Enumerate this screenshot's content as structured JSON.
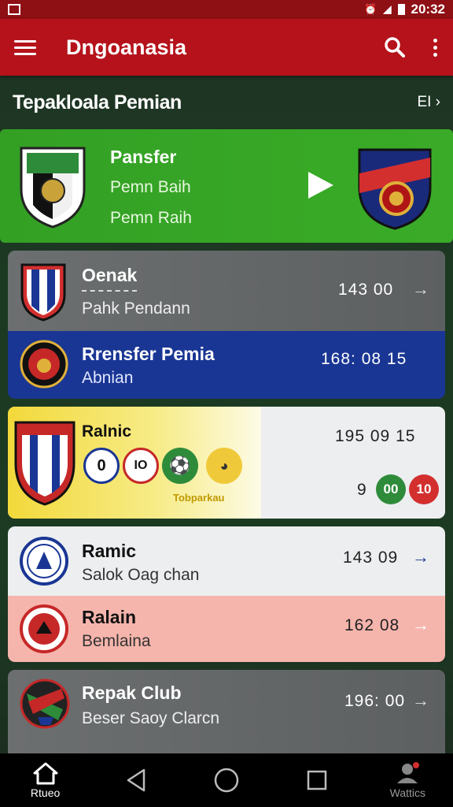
{
  "status_bar": {
    "time": "20:32"
  },
  "app_bar": {
    "title": "Dngoanasia"
  },
  "section": {
    "title": "Tepakloala Pemian",
    "link": "EI ›"
  },
  "featured": {
    "title": "Pansfer",
    "line1": "Pemn Baih",
    "line2": "Pemn Raih",
    "colors": {
      "background": "#35a325"
    }
  },
  "matches": [
    {
      "name": "Oenak",
      "subtitle": "Pahk Pendann",
      "time": "143  00",
      "arrow": "→"
    },
    {
      "name": "Rrensfer Pemia",
      "subtitle": "Abnian",
      "time": "168:  08   15"
    },
    {
      "name": "Ralnic",
      "time": "195  09   15",
      "score_left": "9",
      "score_mid": "00",
      "score_right": "10",
      "promo": "Tobparkau",
      "badges": [
        "0",
        "IO",
        "",
        ""
      ]
    },
    {
      "name": "Ramic",
      "subtitle": "Salok Oag chan",
      "time": "143  09",
      "arrow": "→"
    },
    {
      "name": "Ralain",
      "subtitle": "Bemlaina",
      "time": "162  08",
      "arrow": "→"
    },
    {
      "name": "Repak Club",
      "subtitle": "Beser Saoy Clarcn",
      "time": "196:  00",
      "arrow": "→"
    }
  ],
  "nav": {
    "home_label": "Rtueo",
    "profile_label": "Wattics"
  },
  "colors": {
    "app_bar": "#b5121b",
    "accent_green": "#33a024",
    "accent_red": "#d32f2f",
    "blue_row": "#1a3694"
  }
}
